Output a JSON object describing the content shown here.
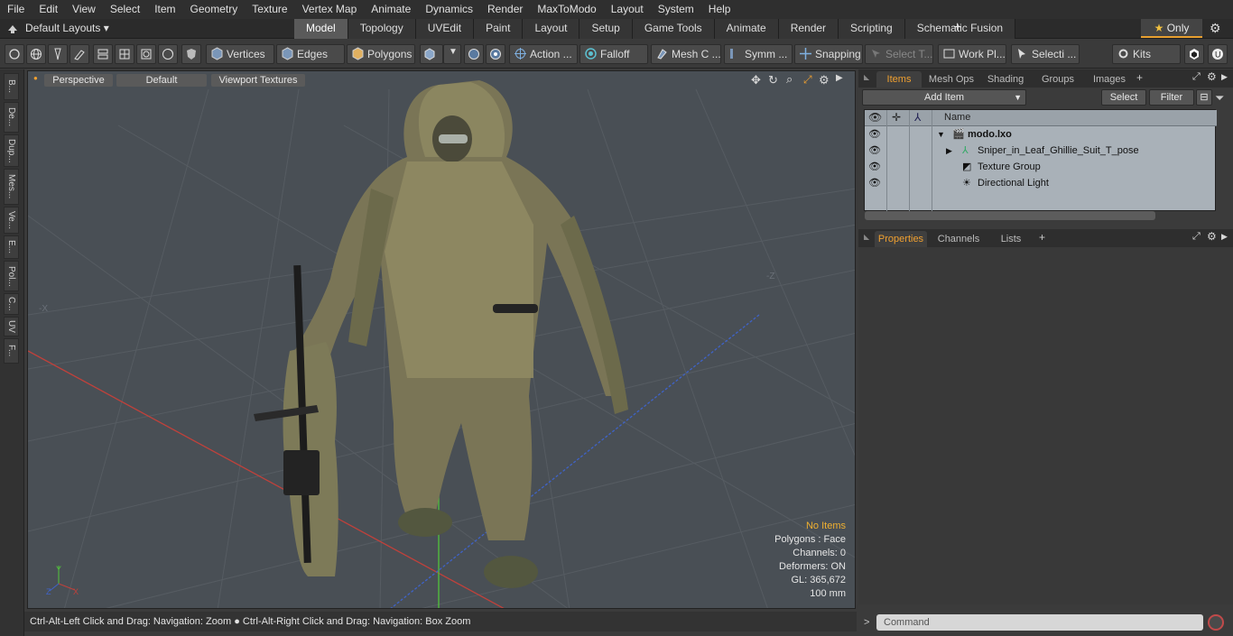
{
  "menu": [
    "File",
    "Edit",
    "View",
    "Select",
    "Item",
    "Geometry",
    "Texture",
    "Vertex Map",
    "Animate",
    "Dynamics",
    "Render",
    "MaxToModo",
    "Layout",
    "System",
    "Help"
  ],
  "layout_bar": {
    "layouts_label": "Default Layouts",
    "tabs": [
      "Model",
      "Topology",
      "UVEdit",
      "Paint",
      "Layout",
      "Setup",
      "Game Tools",
      "Animate",
      "Render",
      "Scripting",
      "Schematic Fusion"
    ],
    "active_tab": "Model",
    "only_label": "Only"
  },
  "toolbar": {
    "vertices": "Vertices",
    "edges": "Edges",
    "polygons": "Polygons",
    "action": "Action ...",
    "falloff": "Falloff",
    "mesh_c": "Mesh C ...",
    "symm": "Symm ...",
    "snapping": "Snapping",
    "select_t": "Select T...",
    "work_pl": "Work Pl...",
    "selecti": "Selecti ...",
    "kits": "Kits"
  },
  "left_tabs": [
    "B...",
    "De...",
    "Dup...",
    "Mes...",
    "Ve...",
    "E...",
    "Pol...",
    "C...",
    "UV",
    "F..."
  ],
  "viewport": {
    "view_mode": "Perspective",
    "shading": "Default",
    "textures": "Viewport Textures",
    "axis_labels": {
      "x": "-X",
      "z": "-Z"
    },
    "info": {
      "selection": "No Items",
      "polygons": "Polygons : Face",
      "channels": "Channels: 0",
      "deformers": "Deformers: ON",
      "gl": "GL: 365,672",
      "scale": "100 mm"
    }
  },
  "status_bar": "Ctrl-Alt-Left Click and Drag: Navigation: Zoom ● Ctrl-Alt-Right Click and Drag: Navigation: Box Zoom",
  "items_panel": {
    "tabs": [
      "Items",
      "Mesh Ops",
      "Shading",
      "Groups",
      "Images"
    ],
    "active_tab": "Items",
    "add_item": "Add Item",
    "select": "Select",
    "filter": "Filter",
    "column_name": "Name",
    "rows": [
      {
        "label": "modo.lxo",
        "indent": 0,
        "icon": "scene-icon"
      },
      {
        "label": "Sniper_in_Leaf_Ghillie_Suit_T_pose",
        "indent": 1,
        "icon": "mesh-icon"
      },
      {
        "label": "Texture Group",
        "indent": 1,
        "icon": "texture-icon"
      },
      {
        "label": "Directional Light",
        "indent": 1,
        "icon": "light-icon"
      }
    ]
  },
  "properties_panel": {
    "tabs": [
      "Properties",
      "Channels",
      "Lists"
    ],
    "active_tab": "Properties"
  },
  "command": {
    "placeholder": "Command"
  },
  "colors": {
    "accent": "#f0a030",
    "viewport_bg": "#494f55",
    "list_bg": "#a9b1b8"
  }
}
